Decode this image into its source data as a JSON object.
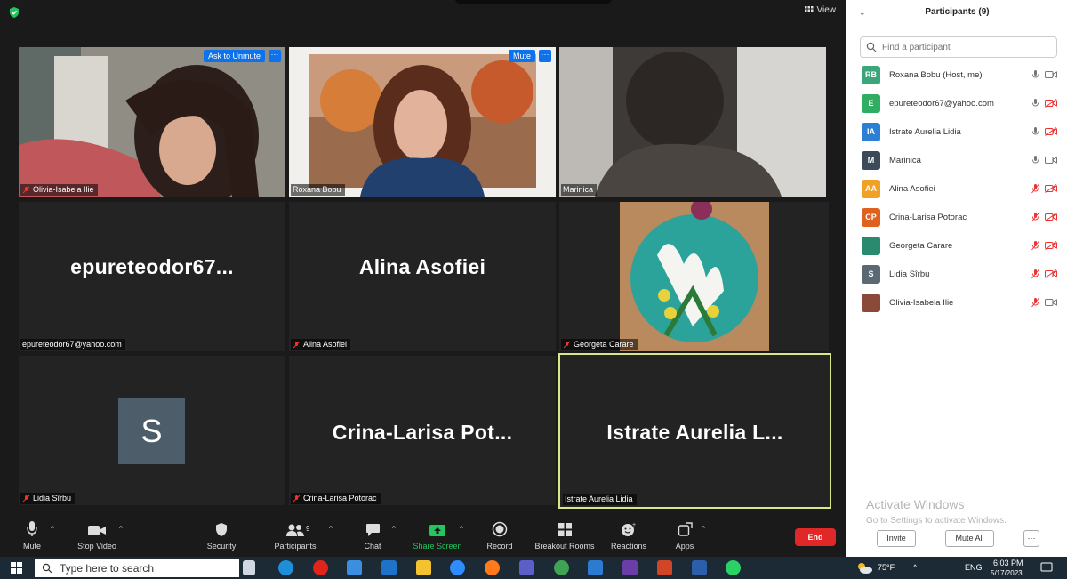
{
  "toolbar_top": {
    "view_label": "View"
  },
  "tiles": [
    {
      "name": "Olivia-Isabela Ilie",
      "button": "Ask to Unmute",
      "more": "···",
      "muted": true
    },
    {
      "name": "Roxana Bobu",
      "button": "Mute",
      "more": "···",
      "muted": false
    },
    {
      "name": "Marinica",
      "muted": false
    },
    {
      "name": "epureteodor67@yahoo.com",
      "big": "epureteodor67...",
      "muted": false
    },
    {
      "name": "Alina Asofiei",
      "big": "Alina Asofiei",
      "muted": true
    },
    {
      "name": "Georgeta Carare",
      "muted": true
    },
    {
      "name": "Lidia Sîrbu",
      "avatar_letter": "S",
      "muted": true
    },
    {
      "name": "Crina-Larisa Potorac",
      "big": "Crina-Larisa  Pot...",
      "muted": true
    },
    {
      "name": "Istrate Aurelia Lidia",
      "big": "Istrate Aurelia L...",
      "muted": false
    }
  ],
  "toolbar": {
    "mute": "Mute",
    "stop_video": "Stop Video",
    "security": "Security",
    "participants": "Participants",
    "participants_count": "9",
    "chat": "Chat",
    "share_screen": "Share Screen",
    "record": "Record",
    "breakout_rooms": "Breakout Rooms",
    "reactions": "Reactions",
    "apps": "Apps",
    "end": "End"
  },
  "panel": {
    "title": "Participants (9)",
    "search_placeholder": "Find a participant",
    "participants": [
      {
        "initials": "RB",
        "name": "Roxana Bobu (Host, me)",
        "color": "#3ba67a"
      },
      {
        "initials": "E",
        "name": "epureteodor67@yahoo.com",
        "color": "#2fae63"
      },
      {
        "initials": "IA",
        "name": "Istrate Aurelia Lidia",
        "color": "#2b7fd4"
      },
      {
        "initials": "M",
        "name": "Marinica",
        "color": "#3c4a5a"
      },
      {
        "initials": "AA",
        "name": "Alina Asofiei",
        "color": "#f0a126"
      },
      {
        "initials": "CP",
        "name": "Crina-Larisa Potorac",
        "color": "#e0601d"
      },
      {
        "initials": "",
        "name": "Georgeta Carare",
        "color": "#2a8a70"
      },
      {
        "initials": "S",
        "name": "Lidia Sîrbu",
        "color": "#5b6975"
      },
      {
        "initials": "",
        "name": "Olivia-Isabela Ilie",
        "color": "#8a4a3a"
      }
    ],
    "activate_title": "Activate Windows",
    "activate_sub": "Go to Settings to activate Windows.",
    "invite": "Invite",
    "mute_all": "Mute All",
    "more": "···"
  },
  "taskbar": {
    "search_placeholder": "Type here to search",
    "temperature": "75°F",
    "language": "ENG",
    "time": "6:03 PM",
    "date": "5/17/2023"
  }
}
